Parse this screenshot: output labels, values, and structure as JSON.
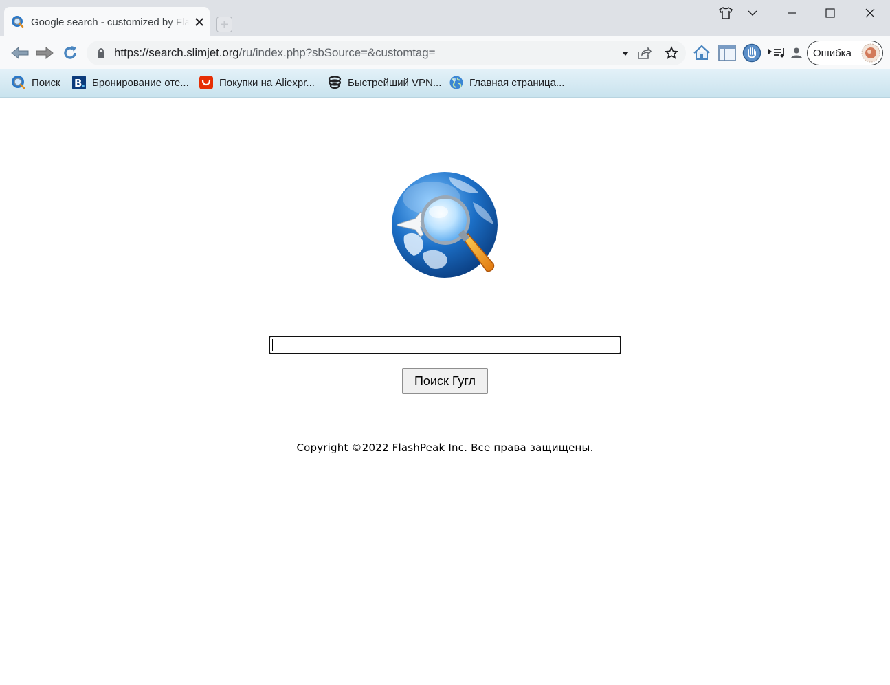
{
  "window": {
    "tab_title": "Google search - customized by FlashPeak",
    "controls": [
      "shirt-icon",
      "tab-search-chevron-icon",
      "minimize-icon",
      "maximize-icon",
      "close-icon"
    ]
  },
  "toolbar": {
    "url_host": "https://search.slimjet.org",
    "url_path": "/ru/index.php?sbSource=&customtag=",
    "profile_label": "Ошибка"
  },
  "bookmarks": [
    {
      "label": "Поиск",
      "icon": "globe-search-icon"
    },
    {
      "label": "Бронирование оте...",
      "icon": "booking-icon"
    },
    {
      "label": "Покупки на Aliexpr...",
      "icon": "aliexpress-icon"
    },
    {
      "label": "Быстрейший VPN...",
      "icon": "vpn-icon"
    },
    {
      "label": "Главная страница...",
      "icon": "globe-icon"
    }
  ],
  "page": {
    "search_value": "",
    "search_button": "Поиск Гугл",
    "copyright": "Copyright ©2022 FlashPeak Inc. Все права защищены."
  },
  "colors": {
    "tabstrip": "#dee1e6",
    "toolbar": "#f8f9fa",
    "bookmark_bar": "#d4eaf3",
    "globe_blue": "#1565c0",
    "magnifier_handle": "#f39c12"
  }
}
